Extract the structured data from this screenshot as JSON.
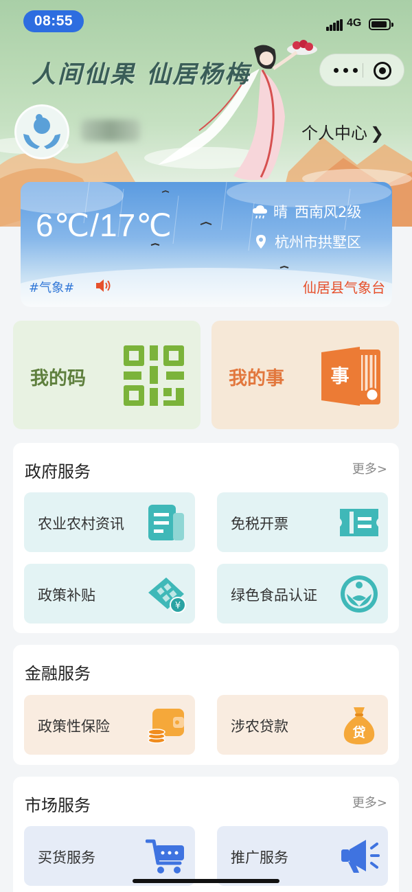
{
  "status_bar": {
    "time": "08:55",
    "network": "4G"
  },
  "header": {
    "slogan": "人间仙果 仙居杨梅",
    "personal_center": "个人中心",
    "chevron": "❯"
  },
  "weather": {
    "temperature": "6℃/17℃",
    "condition": "晴",
    "wind": "西南风2级",
    "location": "杭州市拱墅区",
    "tag": "#气象#",
    "source": "仙居县气象台",
    "icons": {
      "condition": "cloud-rain-icon",
      "location": "location-pin-icon",
      "audio": "speaker-icon"
    }
  },
  "quick_cards": {
    "my_code": "我的码",
    "my_affairs": "我的事",
    "my_affairs_icon_text": "事"
  },
  "sections": {
    "government": {
      "title": "政府服务",
      "more": "更多>",
      "items": [
        {
          "label": "农业农村资讯",
          "icon": "news-document-icon"
        },
        {
          "label": "免税开票",
          "icon": "ticket-icon"
        },
        {
          "label": "政策补贴",
          "icon": "subsidy-yuan-icon"
        },
        {
          "label": "绿色食品认证",
          "icon": "green-food-cert-icon"
        }
      ]
    },
    "finance": {
      "title": "金融服务",
      "items": [
        {
          "label": "政策性保险",
          "icon": "wallet-coins-icon"
        },
        {
          "label": "涉农贷款",
          "icon": "money-bag-icon",
          "icon_text": "贷"
        }
      ]
    },
    "market": {
      "title": "市场服务",
      "more": "更多>",
      "items": [
        {
          "label": "买货服务",
          "icon": "shopping-cart-icon"
        },
        {
          "label": "推广服务",
          "icon": "megaphone-icon"
        }
      ]
    }
  },
  "colors": {
    "time_pill": "#2d6de0",
    "code_green": "#7bb33a",
    "affairs_orange": "#ec7b35",
    "teal_icon": "#3fb8b8",
    "finance_orange": "#f5a83a",
    "market_blue": "#3f73e0",
    "station_red": "#e6502b"
  }
}
